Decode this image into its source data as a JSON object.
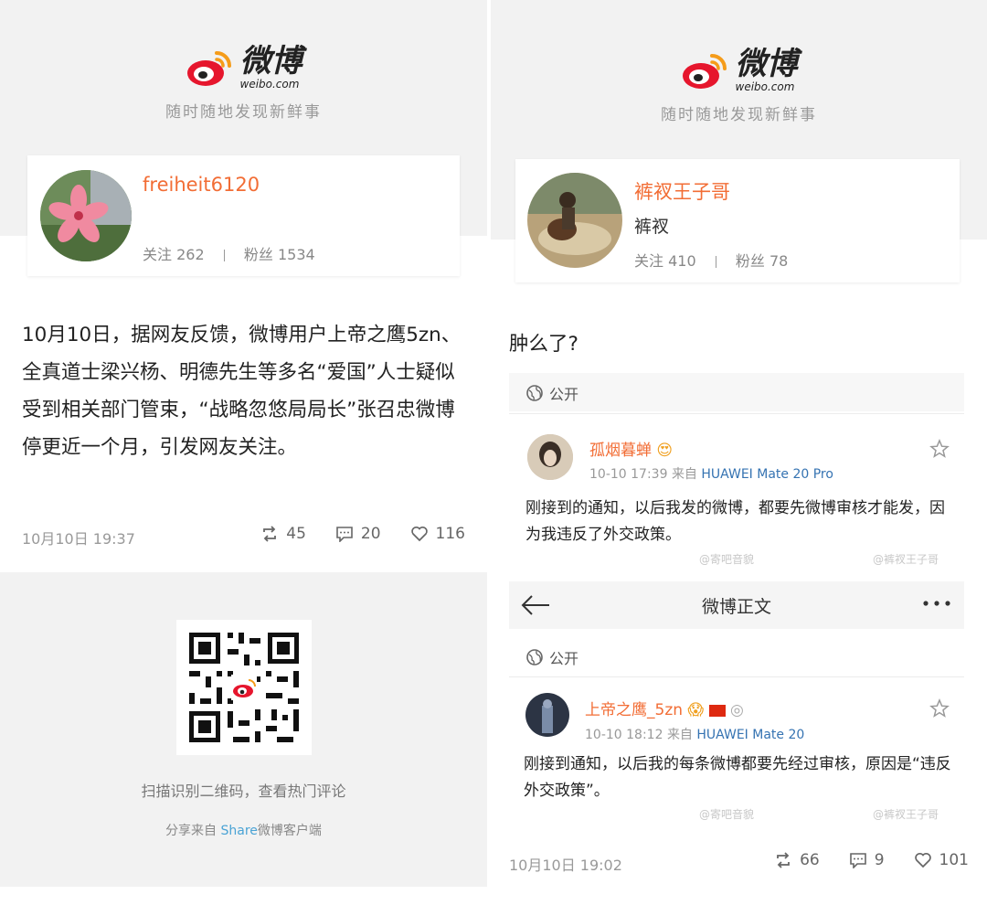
{
  "left": {
    "brand": {
      "logo_cn": "微博",
      "logo_en": "weibo.com",
      "slogan": "随时随地发现新鲜事"
    },
    "profile": {
      "username": "freiheit6120",
      "follow_label": "关注",
      "follow_count": "262",
      "fans_label": "粉丝",
      "fans_count": "1534"
    },
    "post": {
      "text": "10月10日，据网友反馈，微博用户上帝之鹰5zn、全真道士梁兴杨、明德先生等多名“爱国”人士疑似受到相关部门管束，“战略忽悠局局长”张召忠微博停更近一个月，引发网友关注。",
      "timestamp": "10月10日 19:37",
      "reposts": "45",
      "comments": "20",
      "likes": "116"
    },
    "qr": {
      "hint": "扫描识别二维码，查看热门评论",
      "source_prefix": "分享来自 ",
      "source_app": "Share",
      "source_suffix": "微博客户端"
    }
  },
  "right": {
    "brand": {
      "logo_cn": "微博",
      "logo_en": "weibo.com",
      "slogan": "随时随地发现新鲜事"
    },
    "profile": {
      "username": "裤衩王子哥",
      "bio": "裤衩",
      "follow_label": "关注",
      "follow_count": "410",
      "fans_label": "粉丝",
      "fans_count": "78"
    },
    "post": {
      "text": "肿么了?",
      "timestamp": "10月10日 19:02",
      "reposts": "66",
      "comments": "9",
      "likes": "101"
    },
    "shot1": {
      "visibility": "公开",
      "author": "孤烟暮蝉",
      "time": "10-10 17:39",
      "from": "来自",
      "device": "HUAWEI Mate 20 Pro",
      "text": "刚接到的通知，以后我发的微博，都要先微博审核才能发，因为我违反了外交政策。",
      "watermark_left": "@寄吧音貌",
      "watermark_right": "@裤衩王子哥"
    },
    "navbar": {
      "title": "微博正文"
    },
    "shot2": {
      "visibility": "公开",
      "author": "上帝之鹰_5zn",
      "time": "10-10 18:12",
      "from": "来自",
      "device": "HUAWEI Mate 20",
      "text": "刚接到通知，以后我的每条微博都要先经过审核，原因是“违反外交政策”。",
      "watermark_left": "@寄吧音貌",
      "watermark_right": "@裤衩王子哥"
    }
  },
  "colors": {
    "username": "#f26d35",
    "device_link": "#3573b2",
    "share_highlight": "#4aa3d5",
    "weibo_red": "#e6162d",
    "weibo_orange": "#f59c1a"
  }
}
